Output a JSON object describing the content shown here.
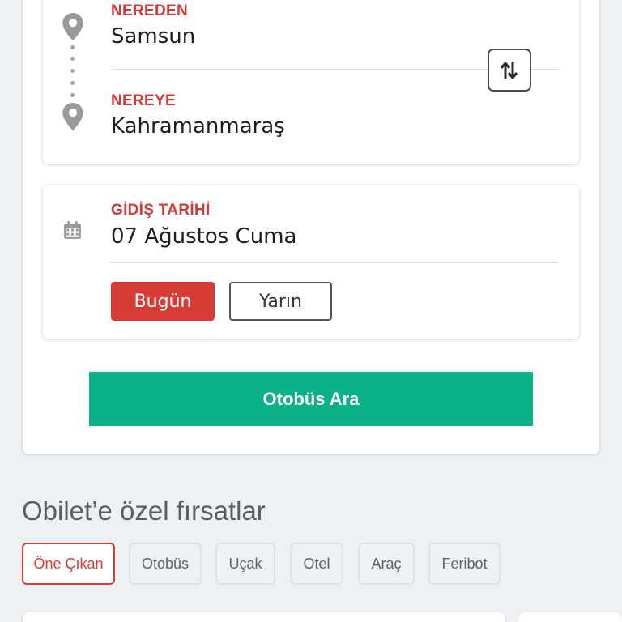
{
  "route": {
    "from_label": "NEREDEN",
    "from_value": "Samsun",
    "to_label": "NEREYE",
    "to_value": "Kahramanmaraş"
  },
  "date": {
    "label": "GİDİŞ TARİHİ",
    "value": "07 Ağustos Cuma",
    "today_label": "Bugün",
    "tomorrow_label": "Yarın"
  },
  "search": {
    "button_label": "Otobüs Ara"
  },
  "deals": {
    "title": "Obilet’e özel fırsatlar",
    "tabs": [
      {
        "label": "Öne Çıkan",
        "active": true
      },
      {
        "label": "Otobüs",
        "active": false
      },
      {
        "label": "Uçak",
        "active": false
      },
      {
        "label": "Otel",
        "active": false
      },
      {
        "label": "Araç",
        "active": false
      },
      {
        "label": "Feribot",
        "active": false
      }
    ]
  },
  "colors": {
    "accent_red": "#d63b36",
    "search_green": "#0db187",
    "icon_gray": "#9a9a9a"
  },
  "icons": {
    "origin": "location-pin-icon",
    "destination": "location-pin-icon",
    "swap": "swap-arrows-icon",
    "calendar": "calendar-icon"
  }
}
